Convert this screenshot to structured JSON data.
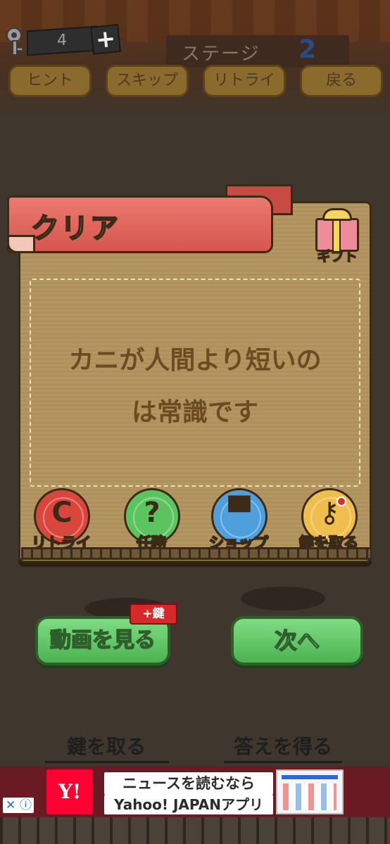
{
  "hud": {
    "key_count": "4",
    "plus_label": "+",
    "stage_label": "ステージ",
    "stage_number": "2",
    "buttons": [
      "ヒント",
      "スキップ",
      "リトライ",
      "戻る"
    ]
  },
  "modal": {
    "title": "クリア",
    "gift_label": "ギフト",
    "message_line1": "カニが人間より短いの",
    "message_line2": "は常識です",
    "actions": [
      {
        "label": "リトライ",
        "glyph": "C",
        "color": "#d9473c"
      },
      {
        "label": "任務",
        "glyph": "?",
        "color": "#5cc45e"
      },
      {
        "label": "ショップ",
        "glyph": "▀",
        "color": "#4f9fdc"
      },
      {
        "label": "鍵を取る",
        "glyph": "⚷",
        "color": "#f0be4c"
      }
    ]
  },
  "buttons": {
    "watch_video": "動画を見る",
    "watch_badge": "+鍵",
    "next": "次へ"
  },
  "bottom_links": {
    "get_key": "鍵を取る",
    "get_answer": "答えを得る"
  },
  "ad": {
    "close_x": "✕",
    "info": "ⓘ",
    "logo": "Y!",
    "line1": "ニュースを読むなら",
    "line2": "Yahoo! JAPANアプリ"
  },
  "colors": {
    "ribbon": "#d5564e",
    "title_text": "#fbe066",
    "message_text": "#6e4a22",
    "green_button": "#4cb352",
    "badge": "#d42a2a"
  }
}
